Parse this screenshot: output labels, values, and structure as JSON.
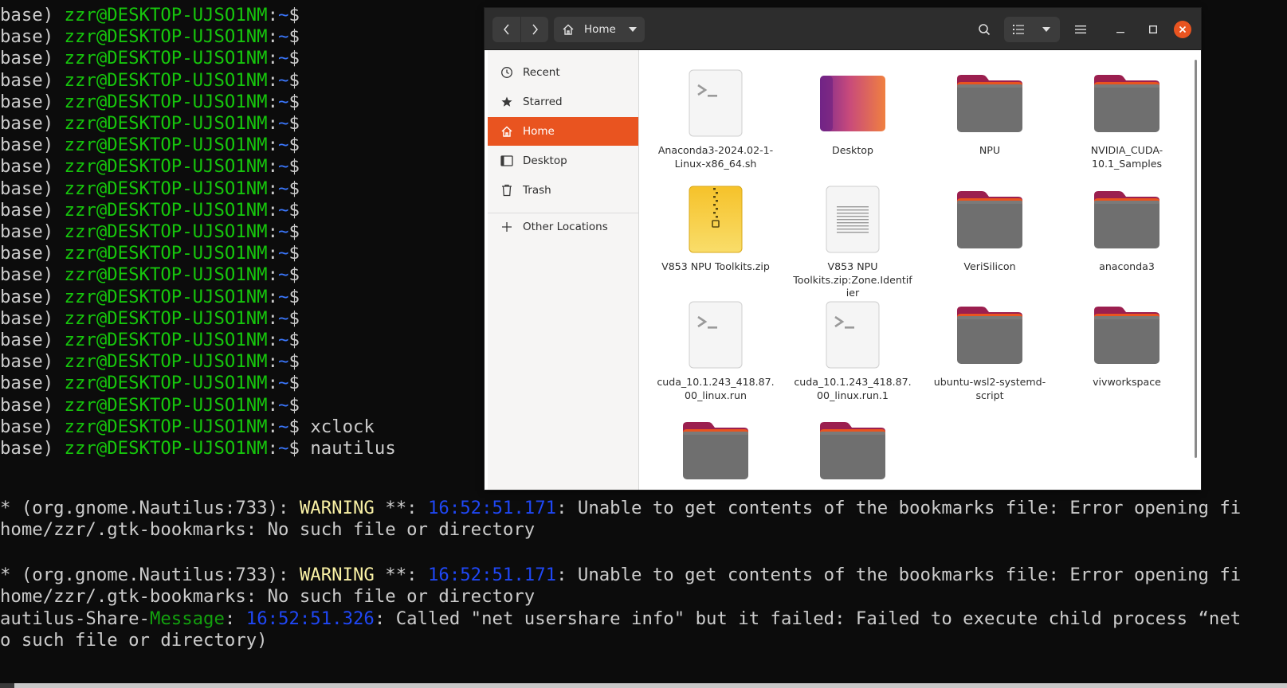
{
  "terminal": {
    "prompt_prefix": "base) ",
    "user_host": "zzr@DESKTOP-UJSO1NM",
    "prompt_sep": ":",
    "path": "~",
    "dollar": "$",
    "commands": [
      "",
      "",
      "",
      "",
      "",
      "",
      "",
      "",
      "",
      "",
      "",
      "",
      "",
      "",
      "",
      "",
      "",
      "",
      "",
      " xclock",
      " nautilus"
    ],
    "warn1": {
      "prefix": "* (org.gnome.Nautilus:733): ",
      "level": "WARNING",
      "stars": " **: ",
      "time": "16:52:51.171",
      "message": ": Unable to get contents of the bookmarks file: Error opening fi",
      "cont": "home/zzr/.gtk-bookmarks: No such file or directory"
    },
    "warn2": {
      "prefix": "* (org.gnome.Nautilus:733): ",
      "level": "WARNING",
      "stars": " **: ",
      "time": "16:52:51.171",
      "message": ": Unable to get contents of the bookmarks file: Error opening fi",
      "cont": "home/zzr/.gtk-bookmarks: No such file or directory"
    },
    "share": {
      "prefix": "autilus-Share-",
      "label": "Message",
      "sep": ": ",
      "time": "16:52:51.326",
      "message": ": Called \"net usershare info\" but it failed: Failed to execute child process “net",
      "cont": "o such file or directory)"
    }
  },
  "window": {
    "path_label": "Home",
    "sidebar": [
      {
        "label": "Recent",
        "icon": "clock-icon"
      },
      {
        "label": "Starred",
        "icon": "star-icon"
      },
      {
        "label": "Home",
        "icon": "home-icon",
        "active": true
      },
      {
        "label": "Desktop",
        "icon": "desktop-icon"
      },
      {
        "label": "Trash",
        "icon": "trash-icon"
      },
      {
        "label": "Other Locations",
        "icon": "plus-icon"
      }
    ],
    "files": [
      {
        "name": "Anaconda3-2024.02-1-Linux-x86_64.sh",
        "type": "script"
      },
      {
        "name": "Desktop",
        "type": "desktop"
      },
      {
        "name": "NPU",
        "type": "folder"
      },
      {
        "name": "NVIDIA_CUDA-10.1_Samples",
        "type": "folder"
      },
      {
        "name": "V853 NPU Toolkits.zip",
        "type": "zip"
      },
      {
        "name": "V853 NPU Toolkits.zip:Zone.Identifier",
        "type": "text"
      },
      {
        "name": "VeriSilicon",
        "type": "folder"
      },
      {
        "name": "anaconda3",
        "type": "folder"
      },
      {
        "name": "cuda_10.1.243_418.87.00_linux.run",
        "type": "script"
      },
      {
        "name": "cuda_10.1.243_418.87.00_linux.run.1",
        "type": "script"
      },
      {
        "name": "ubuntu-wsl2-systemd-script",
        "type": "folder"
      },
      {
        "name": "vivworkspace",
        "type": "folder"
      },
      {
        "name": "",
        "type": "folder"
      },
      {
        "name": "",
        "type": "folder"
      }
    ]
  },
  "colors": {
    "accent": "#e95420",
    "terminal_bg": "#0c0c0c",
    "prompt_green": "#16c60c",
    "prompt_blue": "#3b78ff",
    "warning_yellow": "#f9f1a5",
    "time_blue": "#1f47f5"
  }
}
